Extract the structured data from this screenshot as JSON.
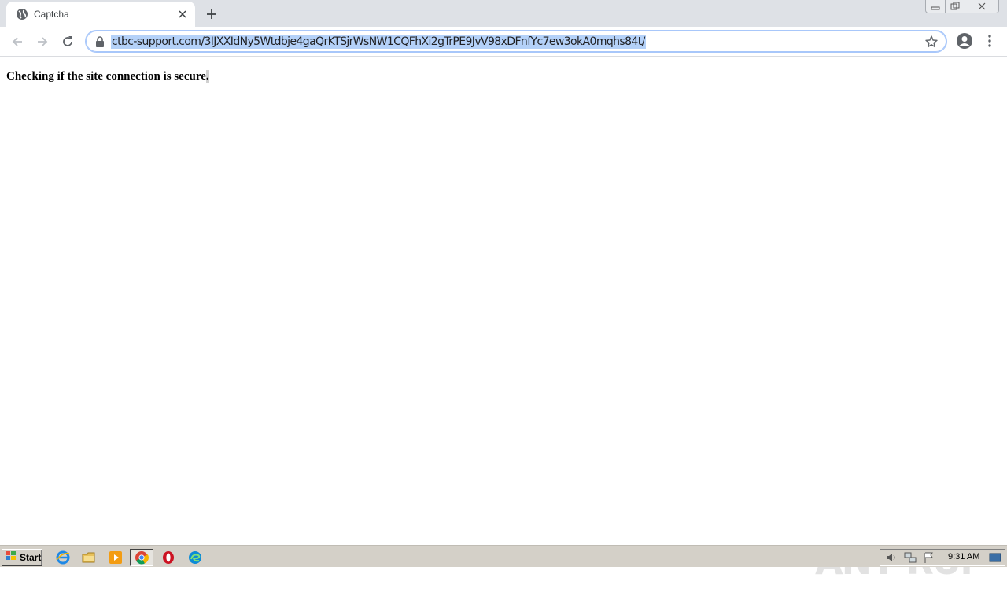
{
  "browser": {
    "tab": {
      "title": "Captcha",
      "favicon": "globe-icon"
    },
    "new_tab_icon": "plus-icon",
    "url": "ctbc-support.com/3IJXXIdNy5Wtdbje4gaQrKTSjrWsNW1CQFhXi2gTrPE9JvV98xDFnfYc7ew3okA0mqhs84t/",
    "icons": [
      "back-arrow-icon",
      "forward-arrow-icon",
      "reload-icon",
      "lock-icon",
      "star-icon",
      "profile-icon",
      "kebab-menu-icon"
    ]
  },
  "page": {
    "message": "Checking if the site connection is secure",
    "message_end": "."
  },
  "watermark": {
    "text": "ANY RUN"
  },
  "taskbar": {
    "start_label": "Start",
    "clock": "9:31 AM",
    "apps": [
      "internet-explorer-icon",
      "folder-icon",
      "media-player-icon",
      "chrome-icon",
      "opera-icon",
      "edge-icon"
    ]
  },
  "colors": {
    "url_selection": "#b4d1f8",
    "tabstrip": "#dee1e6",
    "taskbar": "#d4d0c8"
  }
}
